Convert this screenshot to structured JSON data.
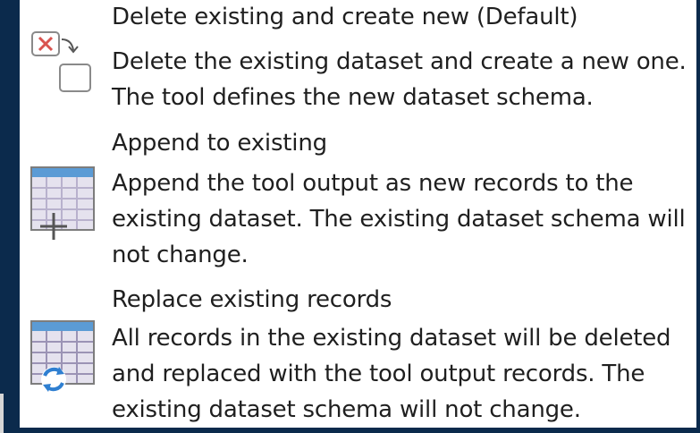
{
  "options": [
    {
      "icon": "delete-create-icon",
      "title": "Delete existing and create new (Default)",
      "desc": [
        "Delete the existing dataset and create a new one.",
        "The tool defines the new dataset schema."
      ]
    },
    {
      "icon": "append-table-icon",
      "title": "Append to existing",
      "desc": [
        "Append the tool output as new records to the",
        "existing dataset. The existing dataset schema will",
        "not change."
      ]
    },
    {
      "icon": "replace-table-icon",
      "title": "Replace existing records",
      "desc": [
        "All records in the existing dataset will be deleted",
        "and replaced with the tool output records. The",
        "existing dataset schema will not change."
      ]
    }
  ],
  "colors": {
    "background": "#0b2a4c",
    "panel": "#ffffff",
    "text": "#1f1f1f",
    "delete_red": "#d9534f",
    "table_header": "#5b9bd5",
    "table_grid": "#9b93b5",
    "refresh_blue": "#2f7fd1"
  }
}
